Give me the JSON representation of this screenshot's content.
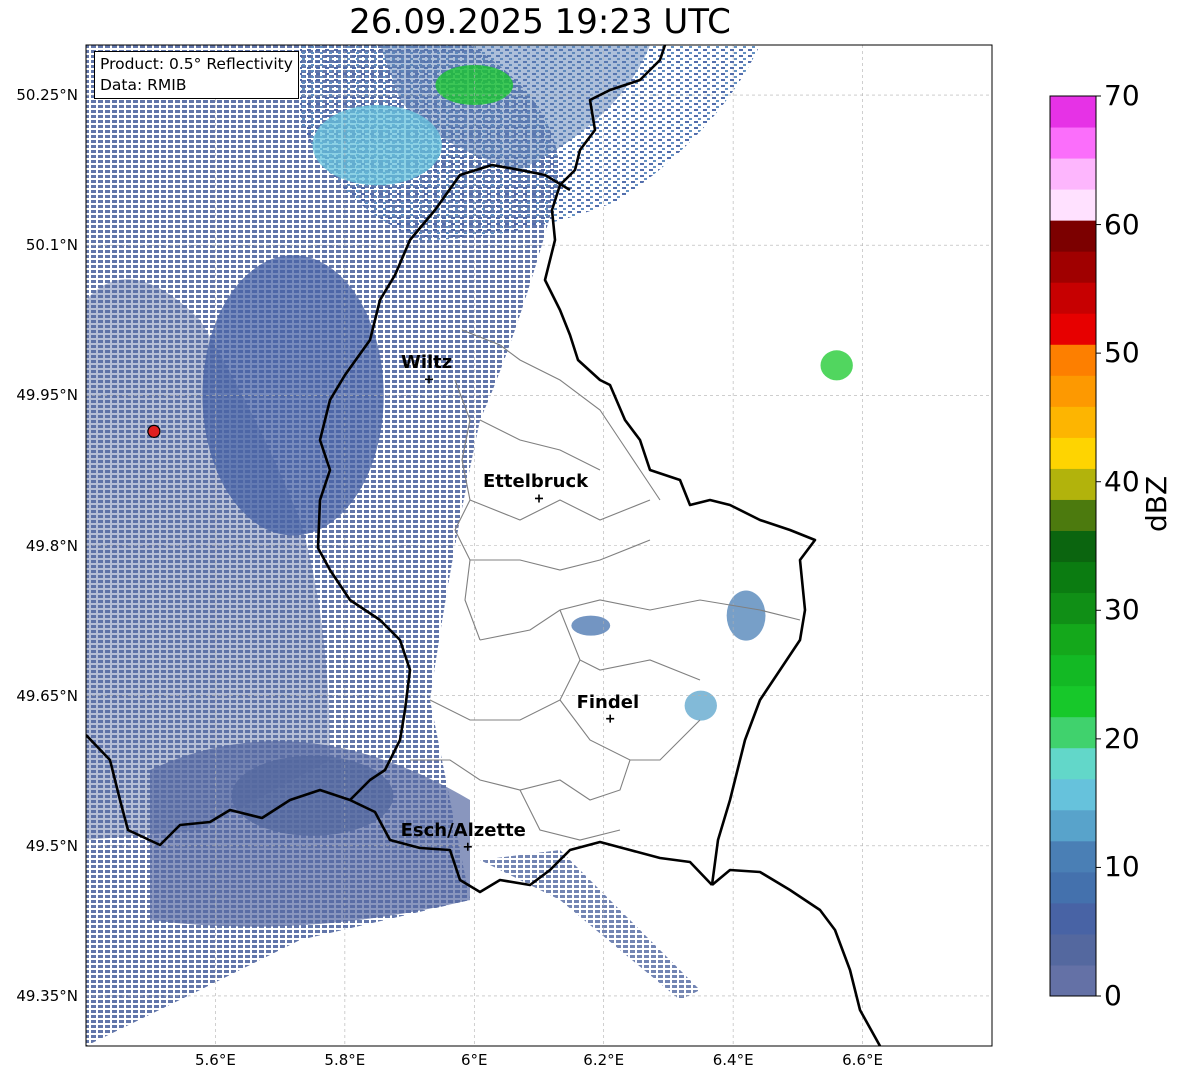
{
  "title": "26.09.2025 19:23 UTC",
  "info": {
    "product": "Product: 0.5° Reflectivity",
    "source": "Data: RMIB"
  },
  "map": {
    "lon_range": [
      5.4,
      6.8
    ],
    "lat_range": [
      49.3,
      50.3
    ],
    "lat_ticks": [
      {
        "value": 50.25,
        "label": "50.25°N"
      },
      {
        "value": 50.1,
        "label": "50.1°N"
      },
      {
        "value": 49.95,
        "label": "49.95°N"
      },
      {
        "value": 49.8,
        "label": "49.8°N"
      },
      {
        "value": 49.65,
        "label": "49.65°N"
      },
      {
        "value": 49.5,
        "label": "49.5°N"
      },
      {
        "value": 49.35,
        "label": "49.35°N"
      }
    ],
    "lon_ticks": [
      {
        "value": 5.6,
        "label": "5.6°E"
      },
      {
        "value": 5.8,
        "label": "5.8°E"
      },
      {
        "value": 6.0,
        "label": "6°E"
      },
      {
        "value": 6.2,
        "label": "6.2°E"
      },
      {
        "value": 6.4,
        "label": "6.4°E"
      },
      {
        "value": 6.6,
        "label": "6.6°E"
      }
    ],
    "radar_site": {
      "lon": 5.505,
      "lat": 49.914,
      "color": "#e02020"
    },
    "cities": [
      {
        "name": "Wiltz",
        "lon": 5.93,
        "lat": 49.966
      },
      {
        "name": "Ettelbruck",
        "lon": 6.1,
        "lat": 49.847
      },
      {
        "name": "Findel",
        "lon": 6.21,
        "lat": 49.627
      },
      {
        "name": "Esch/Alzette",
        "lon": 5.99,
        "lat": 49.499
      }
    ],
    "echo_clusters": [
      {
        "lon": 5.72,
        "lat": 49.95,
        "rx": 0.28,
        "ry": 0.28,
        "level": 4
      },
      {
        "lon": 5.85,
        "lat": 50.2,
        "rx": 0.2,
        "ry": 0.08,
        "level": 14
      },
      {
        "lon": 6.0,
        "lat": 50.26,
        "rx": 0.12,
        "ry": 0.04,
        "level": 22
      },
      {
        "lon": 6.56,
        "lat": 49.98,
        "rx": 0.05,
        "ry": 0.03,
        "level": 22
      },
      {
        "lon": 6.42,
        "lat": 49.73,
        "rx": 0.06,
        "ry": 0.05,
        "level": 10
      },
      {
        "lon": 6.35,
        "lat": 49.64,
        "rx": 0.05,
        "ry": 0.03,
        "level": 12
      },
      {
        "lon": 6.18,
        "lat": 49.72,
        "rx": 0.06,
        "ry": 0.02,
        "level": 8
      },
      {
        "lon": 5.75,
        "lat": 49.55,
        "rx": 0.25,
        "ry": 0.08,
        "level": 3
      }
    ]
  },
  "colorbar": {
    "label": "dBZ",
    "min": 0,
    "max": 70,
    "ticks": [
      "0",
      "10",
      "20",
      "30",
      "40",
      "50",
      "60",
      "70"
    ],
    "colors": [
      "#6471a6",
      "#54689f",
      "#4863a5",
      "#4471ad",
      "#4a7fb5",
      "#58a3cb",
      "#66c2dc",
      "#62d7c9",
      "#40d26d",
      "#17c82a",
      "#13b924",
      "#14a81b",
      "#108f16",
      "#0b7c11",
      "#0b650f",
      "#4c7a0e",
      "#b2b30c",
      "#fed401",
      "#fdb501",
      "#fd9901",
      "#fd7f00",
      "#e70000",
      "#c70001",
      "#a00000",
      "#7c0000",
      "#ffe1ff",
      "#fdb6fd",
      "#fb6efb",
      "#e632e6"
    ]
  },
  "colors": {
    "border_country": "#000000",
    "border_admin": "#808080",
    "grid": "#b0b0b0",
    "echo_low": "#5a6fa6"
  }
}
